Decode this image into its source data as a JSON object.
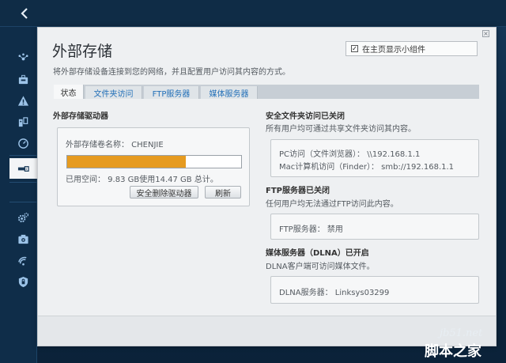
{
  "topbar": {
    "back_icon": "chevron-left-icon"
  },
  "sidebar": {
    "items": [
      {
        "name": "sidebar-item-network-map",
        "icon": "network-map-icon"
      },
      {
        "name": "sidebar-item-guest-access",
        "icon": "briefcase-icon"
      },
      {
        "name": "sidebar-item-troubleshooting",
        "icon": "warning-icon"
      },
      {
        "name": "sidebar-item-parental-controls",
        "icon": "family-icon"
      },
      {
        "name": "sidebar-item-speed-test",
        "icon": "gauge-icon"
      },
      {
        "name": "sidebar-item-external-storage",
        "icon": "usb-icon",
        "active": true
      },
      {
        "name": "sidebar-item-connectivity",
        "icon": "gear-icon"
      },
      {
        "name": "sidebar-item-troubleshoot-2",
        "icon": "camera-icon"
      },
      {
        "name": "sidebar-item-wireless",
        "icon": "wifi-icon"
      },
      {
        "name": "sidebar-item-security",
        "icon": "shield-icon"
      }
    ]
  },
  "modal": {
    "title": "外部存储",
    "description": "将外部存储设备连接到您的网络，并且配置用户访问其内容的方式。",
    "close_icon": "close-icon",
    "widget_toggle": {
      "checked": true,
      "label": "在主页显示小组件"
    }
  },
  "tabs": [
    {
      "label": "状态",
      "active": true
    },
    {
      "label": "文件夹访问",
      "active": false
    },
    {
      "label": "FTP服务器",
      "active": false
    },
    {
      "label": "媒体服务器",
      "active": false
    }
  ],
  "drive": {
    "section_title": "外部存储驱动器",
    "volume_label": "外部存储卷名称：  CHENJIE",
    "usage_fraction": 0.68,
    "usage_text": "已用空间：  9.83 GB使用14.47 GB 总计。",
    "safe_remove_button": "安全删除驱动器",
    "refresh_button": "刷新"
  },
  "secure_folder": {
    "title": "安全文件夹访问已关闭",
    "subtitle": "所有用户均可通过共享文件夹访问其内容。",
    "pc_access": "PC访问（文件浏览器）：  \\\\192.168.1.1",
    "mac_access": "Mac计算机访问（Finder）：  smb://192.168.1.1"
  },
  "ftp": {
    "title": "FTP服务器已关闭",
    "subtitle": "任何用户均无法通过FTP访问此内容。",
    "status": "FTP服务器：  禁用"
  },
  "dlna": {
    "title": "媒体服务器（DLNA）已开启",
    "subtitle": "DLNA客户端可访问媒体文件。",
    "status": "DLNA服务器：  Linksys03299"
  },
  "watermark": {
    "line1": "jb51.net",
    "line2": "脚本之家"
  },
  "colors": {
    "progress_fill": "#e69b20",
    "tab_link": "#2370b8",
    "sidebar_bg": "#0f2d49"
  }
}
